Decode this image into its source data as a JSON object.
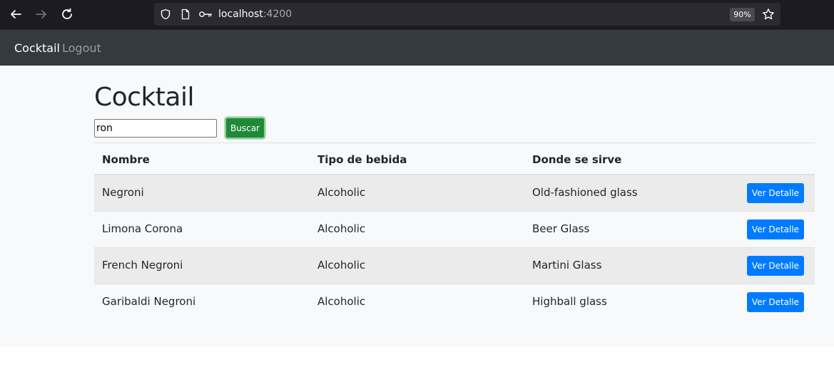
{
  "browser": {
    "url_host": "localhost",
    "url_port": ":4200",
    "zoom": "90%"
  },
  "navbar": {
    "brand": "Cocktail",
    "logout": "Logout"
  },
  "page": {
    "title": "Cocktail",
    "search_value": "ron",
    "search_button": "Buscar"
  },
  "table": {
    "headers": [
      "Nombre",
      "Tipo de bebida",
      "Donde se sirve"
    ],
    "rows": [
      {
        "name": "Negroni",
        "type": "Alcoholic",
        "glass": "Old-fashioned glass",
        "action": "Ver Detalle"
      },
      {
        "name": "Limona Corona",
        "type": "Alcoholic",
        "glass": "Beer Glass",
        "action": "Ver Detalle"
      },
      {
        "name": "French Negroni",
        "type": "Alcoholic",
        "glass": "Martini Glass",
        "action": "Ver Detalle"
      },
      {
        "name": "Garibaldi Negroni",
        "type": "Alcoholic",
        "glass": "Highball glass",
        "action": "Ver Detalle"
      }
    ]
  },
  "colors": {
    "navbar_bg": "#343a40",
    "search_button": "#218838",
    "detail_button": "#007bff"
  }
}
